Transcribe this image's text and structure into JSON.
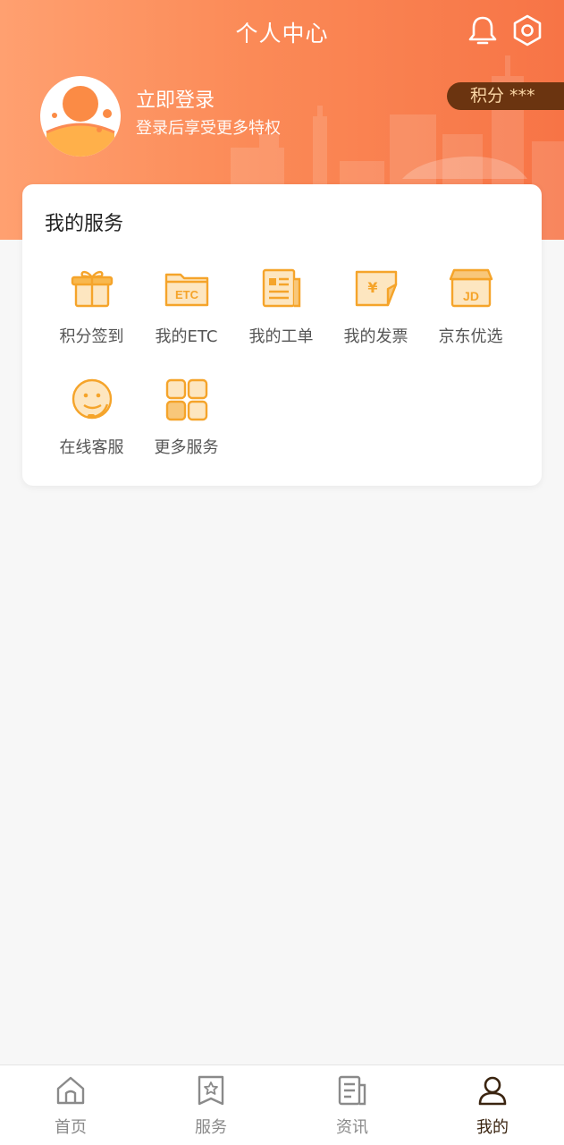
{
  "header": {
    "title": "个人中心",
    "icons": [
      "bell-icon",
      "settings-icon"
    ]
  },
  "profile": {
    "title": "立即登录",
    "subtitle": "登录后享受更多特权"
  },
  "points": {
    "label": "积分 ***"
  },
  "services": {
    "title": "我的服务",
    "items": [
      {
        "label": "积分签到",
        "icon": "gift-icon"
      },
      {
        "label": "我的ETC",
        "icon": "etc-folder-icon"
      },
      {
        "label": "我的工单",
        "icon": "work-order-icon"
      },
      {
        "label": "我的发票",
        "icon": "invoice-icon"
      },
      {
        "label": "京东优选",
        "icon": "jd-store-icon"
      },
      {
        "label": "在线客服",
        "icon": "customer-service-icon"
      },
      {
        "label": "更多服务",
        "icon": "more-grid-icon"
      }
    ]
  },
  "tabbar": {
    "items": [
      {
        "label": "首页",
        "icon": "home-icon"
      },
      {
        "label": "服务",
        "icon": "service-bookmark-icon"
      },
      {
        "label": "资讯",
        "icon": "news-icon"
      },
      {
        "label": "我的",
        "icon": "user-icon"
      }
    ],
    "active": "我的"
  },
  "colors": {
    "accent": "#f5a42a",
    "header_start": "#ffa070",
    "header_end": "#f77446",
    "points_bg": "#6b3410",
    "active_tab": "#3a2410"
  }
}
